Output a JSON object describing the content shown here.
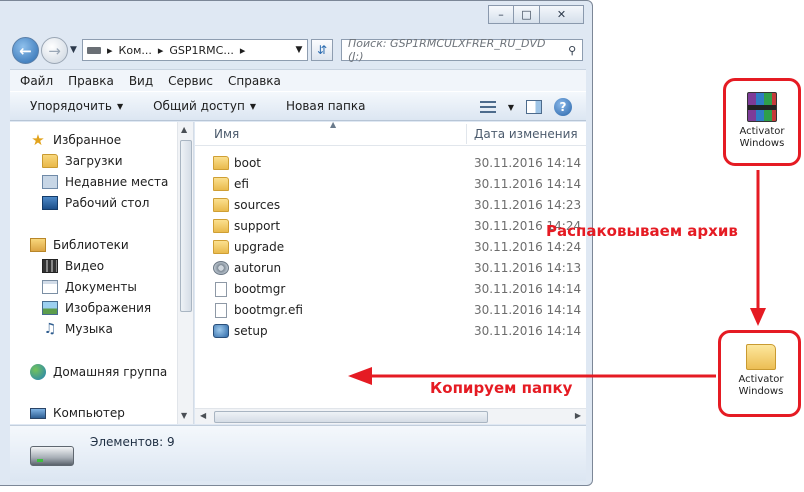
{
  "window": {
    "caption_minimize": "–",
    "caption_maximize": "□",
    "caption_close": "✕"
  },
  "address": {
    "crumb1": "Ком...",
    "crumb2": "GSP1RMC...",
    "search_placeholder": "Поиск: GSP1RMCULXFRER_RU_DVD (J:)"
  },
  "menu": [
    "Файл",
    "Правка",
    "Вид",
    "Сервис",
    "Справка"
  ],
  "toolbar": {
    "organize": "Упорядочить",
    "share": "Общий доступ",
    "new_folder": "Новая папка"
  },
  "nav": {
    "favorites": "Избранное",
    "downloads": "Загрузки",
    "recent": "Недавние места",
    "desktop": "Рабочий стол",
    "libraries": "Библиотеки",
    "video": "Видео",
    "documents": "Документы",
    "images": "Изображения",
    "music": "Музыка",
    "homegroup": "Домашняя группа",
    "computer": "Компьютер"
  },
  "columns": {
    "name": "Имя",
    "date": "Дата изменения"
  },
  "files": [
    {
      "name": "boot",
      "date": "30.11.2016 14:14"
    },
    {
      "name": "efi",
      "date": "30.11.2016 14:14"
    },
    {
      "name": "sources",
      "date": "30.11.2016 14:23"
    },
    {
      "name": "support",
      "date": "30.11.2016 14:24"
    },
    {
      "name": "upgrade",
      "date": "30.11.2016 14:24"
    },
    {
      "name": "autorun",
      "date": "30.11.2016 14:13"
    },
    {
      "name": "bootmgr",
      "date": "30.11.2016 14:14"
    },
    {
      "name": "bootmgr.efi",
      "date": "30.11.2016 14:14"
    },
    {
      "name": "setup",
      "date": "30.11.2016 14:14"
    }
  ],
  "status": {
    "items": "Элементов: 9"
  },
  "desktop": {
    "archive_line1": "Activator",
    "archive_line2": "Windows",
    "folder_line1": "Activator",
    "folder_line2": "Windows"
  },
  "annotations": {
    "unpack": "Распаковываем архив",
    "copy": "Копируем папку"
  },
  "colors": {
    "annotation_red": "#e51b23",
    "window_frame": "#dfe8f3"
  }
}
